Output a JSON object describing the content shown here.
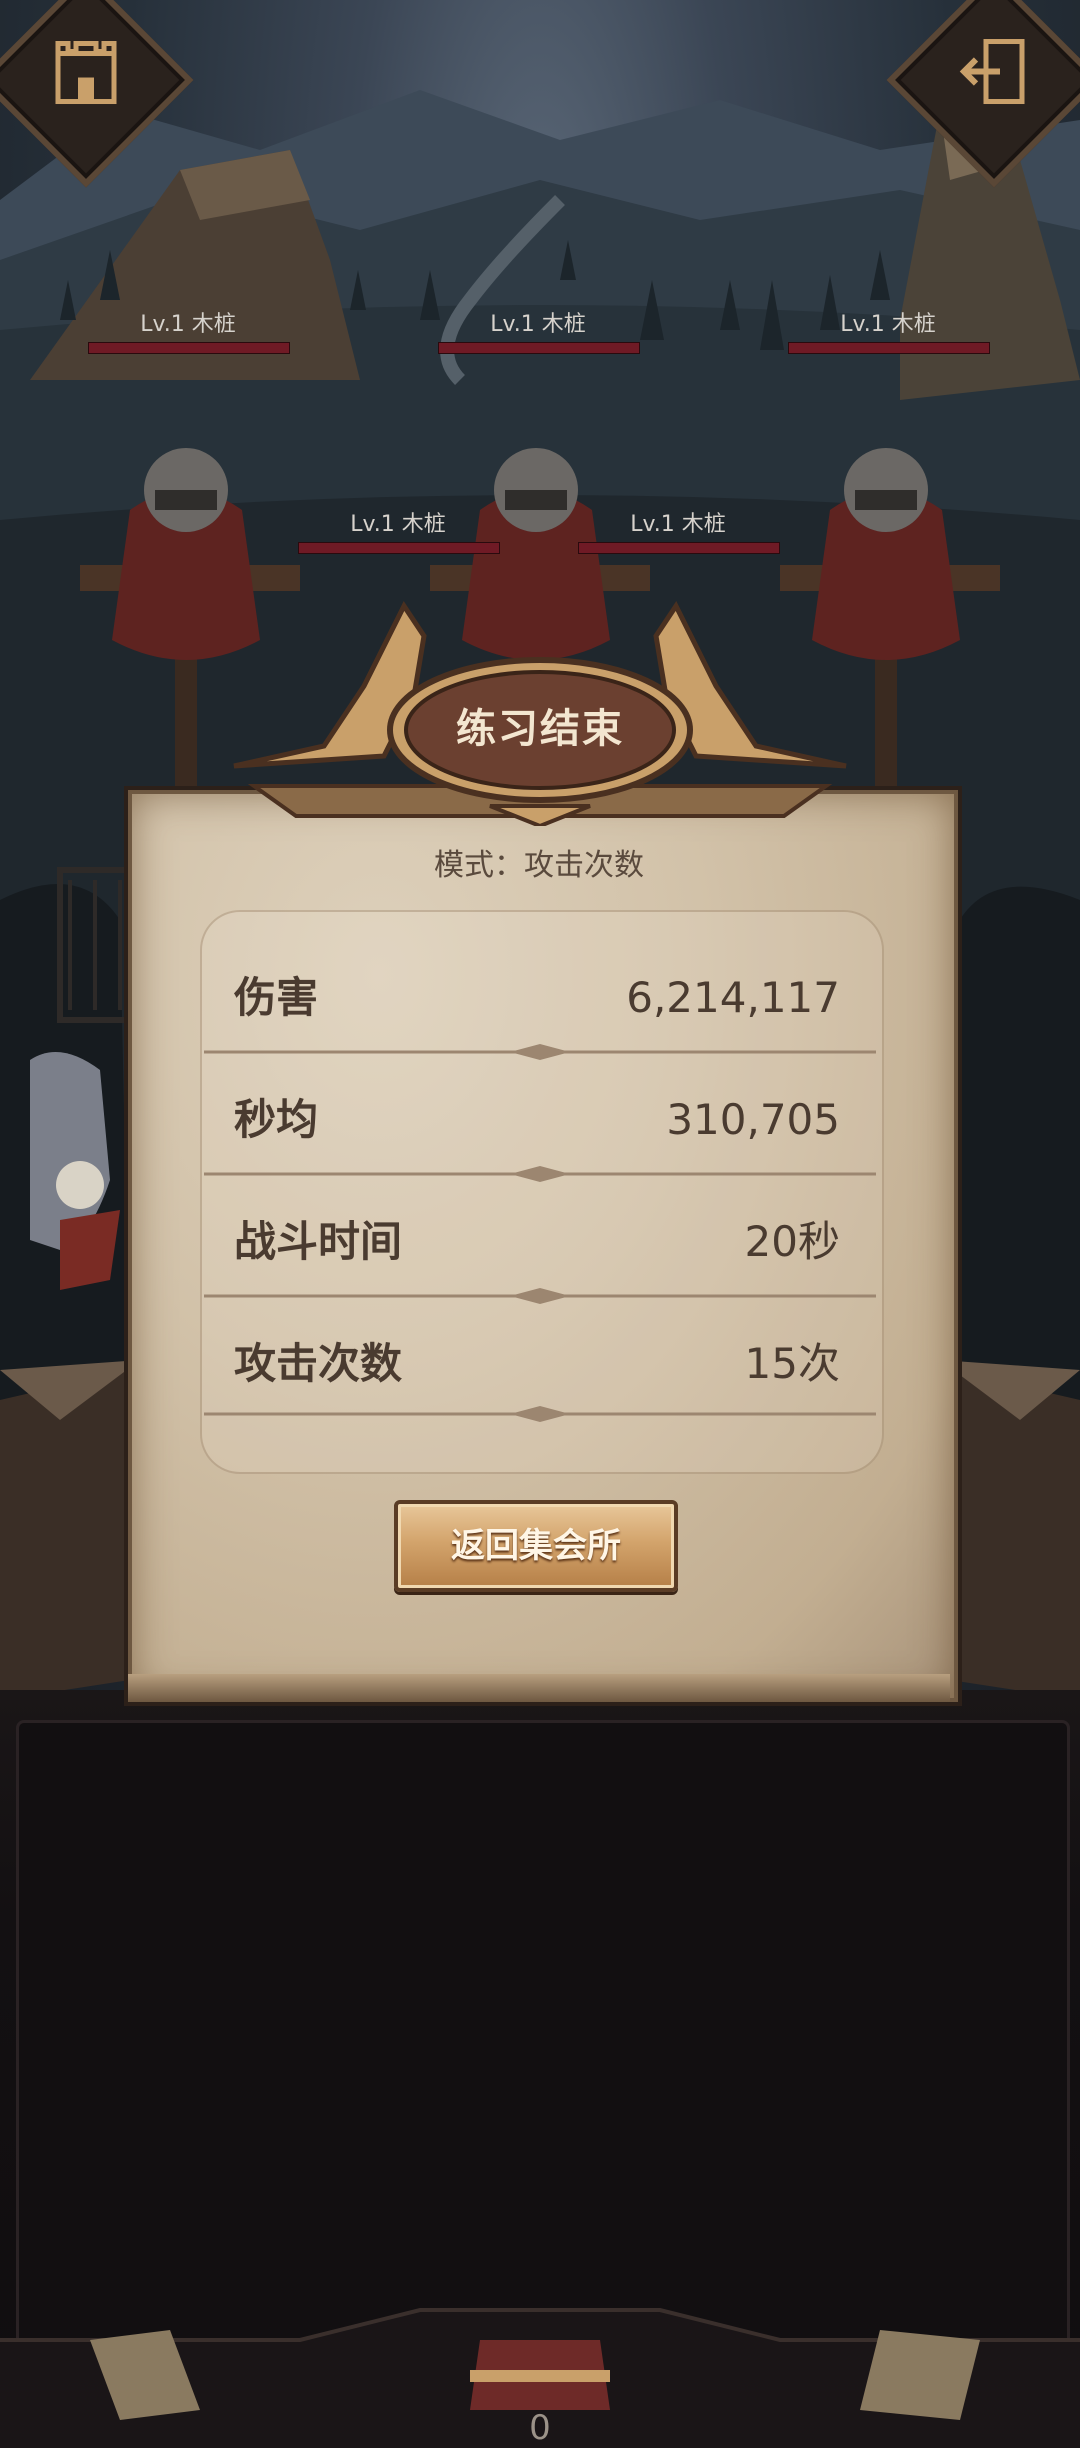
{
  "enemies": [
    {
      "label": "Lv.1  木桩"
    },
    {
      "label": "Lv.1  木桩"
    },
    {
      "label": "Lv.1  木桩"
    },
    {
      "label": "Lv.1  木桩"
    },
    {
      "label": "Lv.1  木桩"
    }
  ],
  "result_panel": {
    "title": "练习结束",
    "mode": "模式：攻击次数",
    "stats": [
      {
        "label": "伤害",
        "value": "6,214,117"
      },
      {
        "label": "秒均",
        "value": "310,705"
      },
      {
        "label": "战斗时间",
        "value": "20秒"
      },
      {
        "label": "攻击次数",
        "value": "15次"
      }
    ],
    "return_button": "返回集会所"
  },
  "bottom_nav": {
    "count": "0"
  },
  "colors": {
    "panel_paper": "#d2c2a9",
    "panel_text": "#4a3b30",
    "crest_brown": "#6b4030",
    "crest_gold": "#c9a06a",
    "hp_bar": "#6f1a25",
    "button_gold": "#d3a46c"
  }
}
